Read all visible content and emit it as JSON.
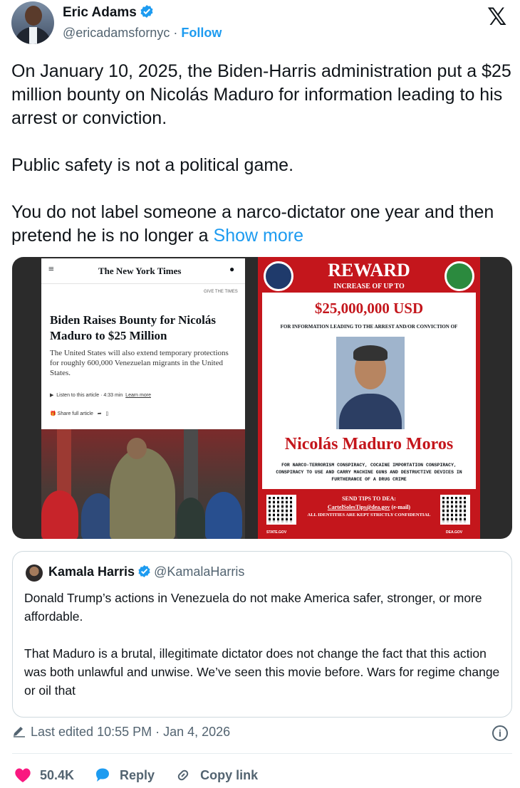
{
  "author": {
    "name": "Eric Adams",
    "handle": "@ericadamsfornyc",
    "separator": "·",
    "follow_label": "Follow"
  },
  "tweet": {
    "paragraphs": [
      "On January 10, 2025, the Biden-Harris administration put a $25 million bounty on Nicolás Maduro for information leading to his arrest or conviction.",
      "Public safety is not a political game."
    ],
    "last_paragraph": "You do not label someone a narco-dictator one year and then pretend he is no longer a",
    "show_more": "Show more"
  },
  "media": {
    "nyt": {
      "logo": "The New York Times",
      "give": "GIVE THE TIMES",
      "headline": "Biden Raises Bounty for Nicolás Maduro to $25 Million",
      "subhead": "The United States will also extend temporary protections for roughly 600,000 Venezuelan migrants in the United States.",
      "listen": "Listen to this article · 4:33 min",
      "learn": "Learn more",
      "share": "Share full article"
    },
    "poster": {
      "reward": "REWARD",
      "increase": "INCREASE OF UP TO",
      "amount": "$25,000,000 USD",
      "for_info": "FOR INFORMATION LEADING TO THE ARREST AND/OR CONVICTION OF",
      "name": "Nicolás Maduro Moros",
      "charges": "FOR NARCO-TERRORISM CONSPIRACY, COCAINE IMPORTATION CONSPIRACY, CONSPIRACY TO USE AND CARRY MACHINE GUNS AND DESTRUCTIVE DEVICES IN FURTHERANCE OF A DRUG CRIME",
      "send_tips": "SEND TIPS TO DEA:",
      "email": "CartelSolesTips@dea.gov",
      "email_suffix": "(e-mail)",
      "identities": "ALL IDENTITIES ARE KEPT STRICTLY CONFIDENTIAL",
      "site_left": "STATE.GOV",
      "site_right": "DEA.GOV"
    }
  },
  "quote": {
    "name": "Kamala Harris",
    "handle": "@KamalaHarris",
    "paragraphs": [
      "Donald Trump’s actions in Venezuela do not make America safer, stronger, or more affordable.",
      "That Maduro is a brutal, illegitimate dictator does not change the fact that this action was both unlawful and unwise. We’ve seen this movie before. Wars for regime change or oil that"
    ]
  },
  "meta": {
    "edited": "Last edited 10:55 PM · Jan 4, 2026",
    "info_icon": "i"
  },
  "actions": {
    "likes": "50.4K",
    "reply": "Reply",
    "copy_link": "Copy link"
  },
  "colors": {
    "accent": "#1d9bf0",
    "like": "#f91880",
    "poster_red": "#c4161c"
  }
}
